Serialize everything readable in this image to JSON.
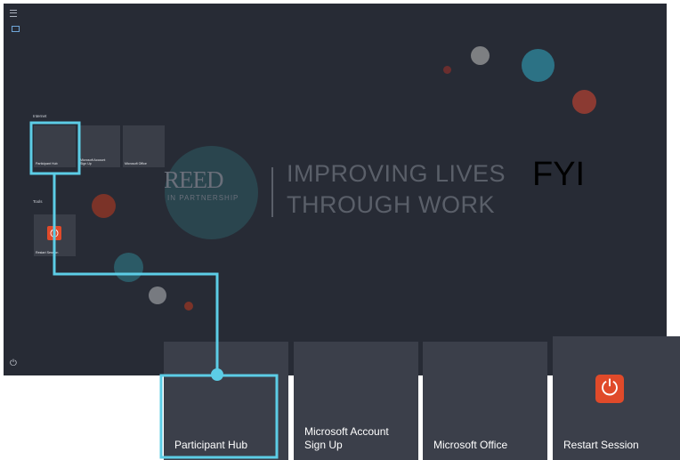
{
  "sections": {
    "internet": "Internet",
    "tools": "Tools"
  },
  "small_tiles": [
    {
      "label": "Participant Hub"
    },
    {
      "label": "Microsoft Account Sign Up"
    },
    {
      "label": "Microsoft Office"
    },
    {
      "label": "Restart Session"
    }
  ],
  "brand": {
    "logo_name": "REED",
    "logo_sub": "IN PARTNERSHIP",
    "slogan_line1": "IMPROVING LIVES",
    "slogan_line2": "THROUGH WORK"
  },
  "annotation": "FYI",
  "zoom_tiles": [
    {
      "label": "Participant Hub"
    },
    {
      "label": "Microsoft Account Sign Up"
    },
    {
      "label": "Microsoft Office"
    },
    {
      "label": "Restart Session"
    }
  ],
  "icons": {
    "menu": "hamburger-icon",
    "power": "power-icon",
    "restart": "power-button-icon"
  },
  "colors": {
    "background": "#272b35",
    "tile": "#3b3f4a",
    "highlight": "#5ccde6",
    "restart_accent": "#e04a2a",
    "annotation_text": "#000000"
  }
}
